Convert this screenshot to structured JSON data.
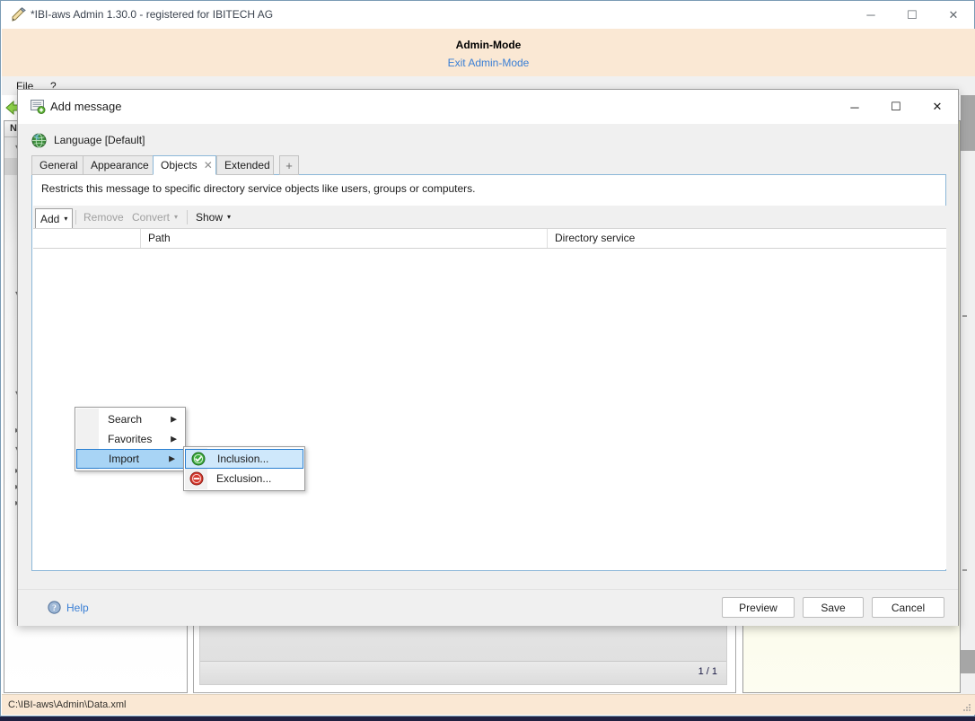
{
  "main_window": {
    "title": "*IBI-aws Admin 1.30.0 - registered for IBITECH AG",
    "title_icon": "pen-icon",
    "minimize": "─",
    "maximize": "☐",
    "close": "✕"
  },
  "admin_banner": {
    "title": "Admin-Mode",
    "exit_link": "Exit Admin-Mode"
  },
  "menubar": {
    "items": [
      {
        "label": "File"
      },
      {
        "label": "?"
      }
    ]
  },
  "background": {
    "left_panel": {
      "column_header": "Na"
    },
    "mid_panel": {
      "page_count": "1 / 1"
    }
  },
  "statusbar": {
    "path": "C:\\IBI-aws\\Admin\\Data.xml"
  },
  "dialog": {
    "title": "Add message",
    "title_icon": "message-add-icon",
    "minimize": "─",
    "maximize": "☐",
    "close": "✕",
    "language": {
      "icon": "globe-icon",
      "label": "Language [Default]"
    },
    "tabs": [
      {
        "label": "General",
        "active": false,
        "closable": false
      },
      {
        "label": "Appearance",
        "active": false,
        "closable": false
      },
      {
        "label": "Objects",
        "active": true,
        "closable": true,
        "close_glyph": "✕"
      },
      {
        "label": "Extended",
        "active": false,
        "closable": false
      },
      {
        "label": "+",
        "active": false,
        "closable": false,
        "is_plus": true
      }
    ],
    "panel": {
      "description": "Restricts this message to specific directory service objects like users, groups or computers.",
      "toolbar": [
        {
          "label": "Add",
          "caret": "▾",
          "enabled": true,
          "open": true
        },
        {
          "label": "Remove",
          "caret": "",
          "enabled": false,
          "open": false
        },
        {
          "label": "Convert",
          "caret": "▾",
          "enabled": false,
          "open": false
        },
        {
          "label": "Show",
          "caret": "▾",
          "enabled": true,
          "open": false
        }
      ],
      "columns": [
        {
          "label": ""
        },
        {
          "label": "Path"
        },
        {
          "label": "Directory service"
        }
      ],
      "rows": []
    },
    "menus": {
      "add": {
        "items": [
          {
            "label": "Search",
            "submenu": true,
            "arrow": "▶",
            "state": "normal"
          },
          {
            "label": "Favorites",
            "submenu": true,
            "arrow": "▶",
            "state": "normal"
          },
          {
            "label": "Import",
            "submenu": true,
            "arrow": "▶",
            "state": "highlight"
          }
        ]
      },
      "import": {
        "items": [
          {
            "label": "Inclusion...",
            "icon": "check-circle-green-icon",
            "state": "selected"
          },
          {
            "label": "Exclusion...",
            "icon": "minus-circle-red-icon",
            "state": "normal"
          }
        ]
      }
    },
    "footer": {
      "help_label": "Help",
      "help_icon": "help-circle-icon",
      "buttons": [
        {
          "label": "Preview"
        },
        {
          "label": "Save"
        },
        {
          "label": "Cancel"
        }
      ]
    }
  },
  "colors": {
    "banner_bg": "#fae8d4",
    "link": "#3a7fd5",
    "menu_highlight": "#a8d4f5",
    "menu_highlight_border": "#2a7fd0",
    "tab_active_border": "#8bb7d8",
    "inclusion_green": "#3cab3c",
    "exclusion_red": "#d63a2f"
  }
}
